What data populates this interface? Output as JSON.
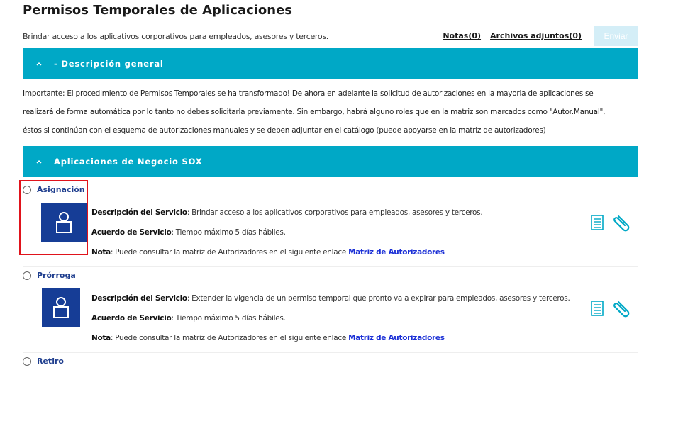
{
  "header": {
    "title": "Permisos Temporales de Aplicaciones",
    "subtitle": "Brindar acceso a los aplicativos corporativos para empleados, asesores y terceros.",
    "notes_label": "Notas(0)",
    "attachments_label": "Archivos adjuntos(0)",
    "send_label": "Enviar"
  },
  "sections": {
    "general": {
      "label": "- Descripción general",
      "icon": "chevron-up-icon",
      "lines": [
        "Importante: El procedimiento de Permisos Temporales se ha transformado! De ahora en adelante la solicitud de autorizaciones en la mayoria de aplicaciones se",
        "realizará de forma automática por lo tanto no debes solicitarla previamente. Sin embargo, habrá alguno roles que en la matriz son marcados como \"Autor.Manual\",",
        "éstos si continúan con el esquema de autorizaciones manuales y se deben adjuntar en el catálogo (puede apoyarse en la matriz de autorizadores)"
      ]
    },
    "sox": {
      "label": "Aplicaciones de Negocio SOX",
      "icon": "chevron-up-icon"
    }
  },
  "services": [
    {
      "name": "Asignación",
      "desc_label": "Descripción del Servicio",
      "desc": ": Brindar acceso a los aplicativos corporativos para empleados, asesores y terceros.",
      "sla_label": "Acuerdo de Servicio",
      "sla": ": Tiempo máximo 5 días hábiles.",
      "note_label": "Nota",
      "note": ": Puede consultar la matriz de Autorizadores en el siguiente enlace ",
      "link": "Matriz de Autorizadores"
    },
    {
      "name": "Prórroga",
      "desc_label": "Descripción del Servicio",
      "desc": ": Extender la vigencia de un permiso temporal que pronto va a expirar para empleados, asesores y terceros.",
      "sla_label": "Acuerdo de Servicio",
      "sla": ": Tiempo máximo 5 días hábiles.",
      "note_label": "Nota",
      "note": ": Puede consultar la matriz de Autorizadores en el siguiente enlace ",
      "link": "Matriz de Autorizadores"
    },
    {
      "name": "Retiro"
    }
  ],
  "colors": {
    "section_header": "#00a8c6",
    "service_icon_bg": "#163d96",
    "link": "#1a2fd6",
    "highlight": "#e0131b",
    "send_disabled": "#d4eef7"
  }
}
